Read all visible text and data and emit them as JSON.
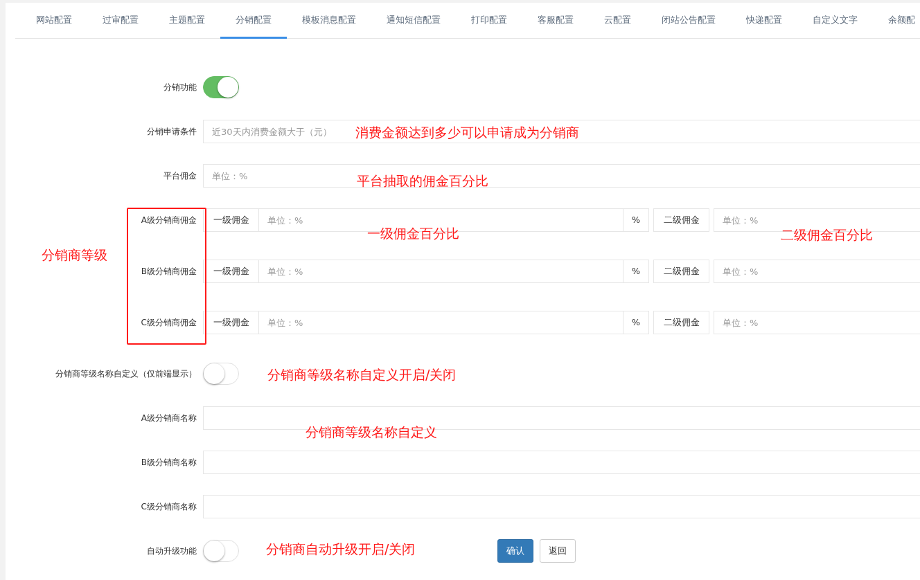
{
  "tabs": [
    {
      "label": "网站配置",
      "selected": false
    },
    {
      "label": "过审配置",
      "selected": false
    },
    {
      "label": "主题配置",
      "selected": false
    },
    {
      "label": "分销配置",
      "selected": true
    },
    {
      "label": "模板消息配置",
      "selected": false
    },
    {
      "label": "通知短信配置",
      "selected": false
    },
    {
      "label": "打印配置",
      "selected": false
    },
    {
      "label": "客服配置",
      "selected": false
    },
    {
      "label": "云配置",
      "selected": false
    },
    {
      "label": "闭站公告配置",
      "selected": false
    },
    {
      "label": "快递配置",
      "selected": false
    },
    {
      "label": "自定义文字",
      "selected": false
    },
    {
      "label": "余额配",
      "selected": false
    }
  ],
  "rows": [
    {
      "kind": "switch",
      "label": "分销功能",
      "on": true
    },
    {
      "kind": "text",
      "label": "分销申请条件",
      "placeholder": "近30天内消费金额大于（元）"
    },
    {
      "kind": "text",
      "label": "平台佣金",
      "placeholder": "单位：%"
    },
    {
      "kind": "commission",
      "label": "A级分销商佣金",
      "first_label": "一级佣金",
      "first_placeholder": "单位：%",
      "unit": "%",
      "second_label": "二级佣金",
      "second_placeholder": "单位：%"
    },
    {
      "kind": "commission",
      "label": "B级分销商佣金",
      "first_label": "一级佣金",
      "first_placeholder": "单位：%",
      "unit": "%",
      "second_label": "二级佣金",
      "second_placeholder": "单位：%"
    },
    {
      "kind": "commission",
      "label": "C级分销商佣金",
      "first_label": "一级佣金",
      "first_placeholder": "单位：%",
      "unit": "%",
      "second_label": "二级佣金",
      "second_placeholder": "单位：%"
    },
    {
      "kind": "switch",
      "label": "分销商等级名称自定义（仅前端显示）",
      "on": false
    },
    {
      "kind": "text",
      "label": "A级分销商名称"
    },
    {
      "kind": "text",
      "label": "B级分销商名称"
    },
    {
      "kind": "text",
      "label": "C级分销商名称"
    },
    {
      "kind": "switch",
      "label": "自动升级功能",
      "on": false
    }
  ],
  "buttons": [
    {
      "label": "确认",
      "kind": "primary"
    },
    {
      "label": "返回",
      "kind": "default"
    }
  ],
  "annotations": [
    {
      "text": "消费金额达到多少可以申请成为分销商"
    },
    {
      "text": "平台抽取的佣金百分比"
    },
    {
      "text": "一级佣金百分比"
    },
    {
      "text": "二级佣金百分比"
    },
    {
      "text": "分销商等级"
    },
    {
      "text": "分销商等级名称自定义开启/关闭"
    },
    {
      "text": "分销商等级名称自定义"
    },
    {
      "text": "分销商自动升级开启/关闭"
    }
  ]
}
